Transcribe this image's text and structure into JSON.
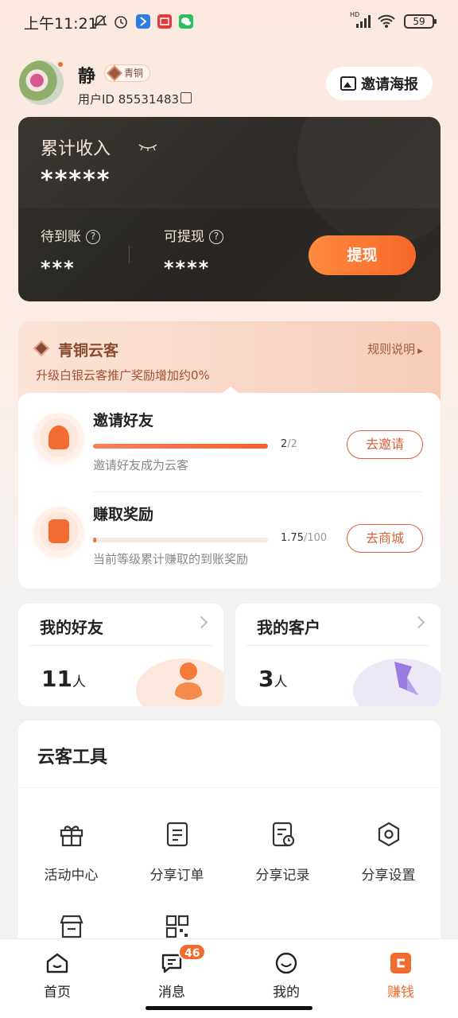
{
  "status_bar": {
    "time": "上午11:21",
    "battery": "59",
    "network_label": "HD"
  },
  "profile": {
    "name": "静",
    "rank_badge": "青铜",
    "user_id": "用户ID 85531483",
    "invite_poster_label": "邀请海报"
  },
  "earnings": {
    "total_label": "累计收入",
    "total_value": "*****",
    "pending_label": "待到账",
    "pending_value": "***",
    "withdrawable_label": "可提现",
    "withdrawable_value": "****",
    "withdraw_button": "提现",
    "help_glyph": "?"
  },
  "tier": {
    "title": "青铜云客",
    "rules_link": "规则说明",
    "description": "升级白银云客推广奖励增加约0%",
    "tasks": [
      {
        "name": "邀请好友",
        "progress_current": "2",
        "progress_total": "/2",
        "progress_fraction": 1.0,
        "hint": "邀请好友成为云客",
        "button": "去邀请"
      },
      {
        "name": "赚取奖励",
        "progress_current": "1.75",
        "progress_total": "/100",
        "progress_fraction": 0.0175,
        "hint": "当前等级累计赚取的到账奖励",
        "button": "去商城"
      }
    ]
  },
  "stats": {
    "friends": {
      "title": "我的好友",
      "count": "11",
      "unit": "人"
    },
    "customers": {
      "title": "我的客户",
      "count": "3",
      "unit": "人"
    }
  },
  "tools": {
    "title": "云客工具",
    "items": [
      {
        "label": "活动中心",
        "icon": "gift-icon"
      },
      {
        "label": "分享订单",
        "icon": "order-icon"
      },
      {
        "label": "分享记录",
        "icon": "record-icon"
      },
      {
        "label": "分享设置",
        "icon": "settings-icon"
      }
    ]
  },
  "tabbar": {
    "items": [
      {
        "label": "首页",
        "icon": "home-icon"
      },
      {
        "label": "消息",
        "icon": "message-icon",
        "badge": "46"
      },
      {
        "label": "我的",
        "icon": "profile-icon"
      },
      {
        "label": "赚钱",
        "icon": "earn-icon",
        "active": true
      }
    ]
  },
  "colors": {
    "accent": "#f26b2e",
    "card_dark": "#2e2b28",
    "tier_text": "#8a4a30"
  }
}
